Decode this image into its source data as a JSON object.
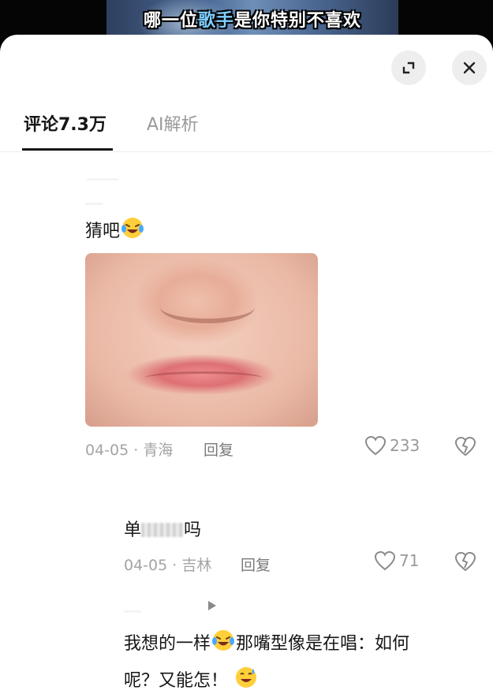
{
  "video": {
    "caption_pre": "哪一位",
    "caption_hl": "歌手",
    "caption_post": "是你特别不喜欢"
  },
  "header": {
    "tabs": [
      {
        "label": "评论7.3万"
      },
      {
        "label": "AI解析"
      }
    ]
  },
  "comments": [
    {
      "text": "猜吧",
      "emoji": "laugh-cry-emoji",
      "image": "lips-closeup-photo",
      "date_location": "04-05 · 青海",
      "reply_label": "回复",
      "likes": "233"
    },
    {
      "text_pre": "单",
      "text_post": "吗",
      "date_location": "04-05 · 吉林",
      "reply_label": "回复",
      "likes": "71"
    },
    {
      "line1": "我想的一样",
      "line1_after": "那嘴型像是在唱：如何",
      "line2": "呢？又能怎！"
    }
  ],
  "colors": {
    "accent_text": "#161616",
    "muted": "#a4a4a4",
    "icon_bg": "#eeeeee"
  }
}
